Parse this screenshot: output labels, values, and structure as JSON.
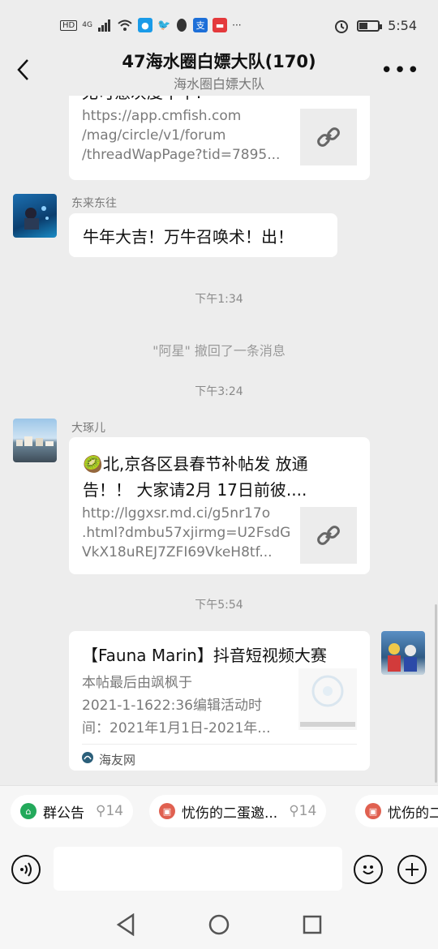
{
  "status_bar": {
    "left_icons": [
      "HD",
      "4G",
      "signal-icon",
      "wifi-icon",
      "app-icon",
      "bird-icon",
      "penguin-icon",
      "app-icon",
      "app-icon",
      "more-dots"
    ],
    "more_dots": "···",
    "time": "5:54"
  },
  "header": {
    "title": "47海水圈白嫖大队(170)",
    "subtitle": "海水圈白嫖大队",
    "more": "•••"
  },
  "messages": {
    "top_card": {
      "cut_title": "无可惫灰度十华!",
      "link_lines": [
        "https://app.cmfish.com",
        "/mag/circle/v1/forum",
        "/threadWapPage?tid=7895..."
      ]
    },
    "msg1": {
      "sender": "东来东往",
      "text": "牛年大吉！万牛召唤术！出！"
    },
    "time1": "下午1:34",
    "recall": "\"阿星\" 撤回了一条消息",
    "time2": "下午3:24",
    "msg2": {
      "sender": "大琢儿",
      "title_line1": "🥝北,京各区县春节补帖发 放通",
      "title_line2": "告！！ 大家请2月  17日前彼....",
      "link_lines": [
        "http://lggxsr.md.ci/g5nr17o",
        ".html?dmbu57xjirmg=U2FsdG",
        "VkX18uREJ7ZFI69VkeH8tf..."
      ]
    },
    "time3": "下午5:54",
    "msg3": {
      "title": "【Fauna Marin】抖音短视频大赛",
      "desc_lines": [
        "本帖最后由飒枫于",
        "2021-1-1622:36编辑活动时",
        "间：2021年1月1日-2021年..."
      ],
      "source": "海友网"
    }
  },
  "chips": [
    {
      "label": "群公告",
      "count": "14",
      "icon_color": "#23a95b"
    },
    {
      "label": "忧伤的二蛋邀...",
      "count": "14",
      "icon_color": "#e06050"
    },
    {
      "label": "忧伤的二蛋",
      "count": "",
      "icon_color": "#e06050"
    }
  ],
  "colors": {
    "background": "#ededed",
    "card": "#ffffff",
    "accent_green": "#23a95b"
  }
}
